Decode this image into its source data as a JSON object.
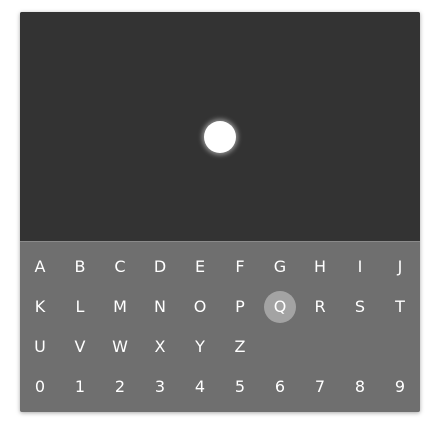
{
  "keyboard": {
    "selected_key": "Q",
    "rows": [
      [
        "A",
        "B",
        "C",
        "D",
        "E",
        "F",
        "G",
        "H",
        "I",
        "J"
      ],
      [
        "K",
        "L",
        "M",
        "N",
        "O",
        "P",
        "Q",
        "R",
        "S",
        "T"
      ],
      [
        "U",
        "V",
        "W",
        "X",
        "Y",
        "Z"
      ],
      [
        "0",
        "1",
        "2",
        "3",
        "4",
        "5",
        "6",
        "7",
        "8",
        "9"
      ]
    ]
  },
  "colors": {
    "display_bg": "#333333",
    "keyboard_bg": "#6f6f6f",
    "selected_key_bg": "#a3a3a3",
    "key_text": "#ffffff",
    "indicator": "#ffffff"
  }
}
